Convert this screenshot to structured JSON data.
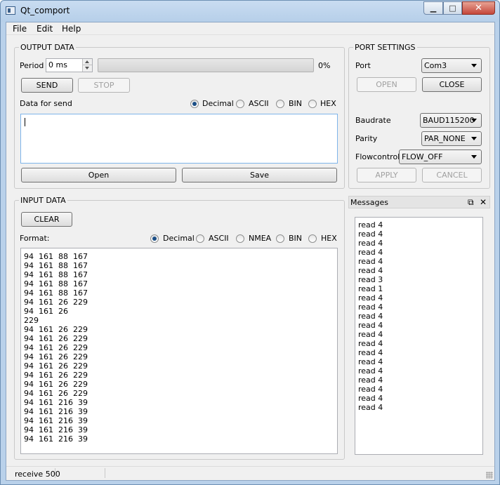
{
  "window": {
    "title": "Qt_comport",
    "minimize": "▁",
    "maximize": "□",
    "close": "✕"
  },
  "menu": [
    "File",
    "Edit",
    "Help"
  ],
  "output": {
    "group_title": "OUTPUT DATA",
    "period_label": "Period",
    "period_value": "0 ms",
    "progress_percent": 0,
    "progress_text": "0%",
    "send_label": "SEND",
    "stop_label": "STOP",
    "data_label": "Data for send",
    "format_options": [
      "Decimal",
      "ASCII",
      "BIN",
      "HEX"
    ],
    "format_selected": "Decimal",
    "text_value": "",
    "open_label": "Open",
    "save_label": "Save"
  },
  "port": {
    "group_title": "PORT SETTINGS",
    "port_label": "Port",
    "port_value": "Com3",
    "open_label": "OPEN",
    "close_label": "CLOSE",
    "baudrate_label": "Baudrate",
    "baudrate_value": "BAUD115200",
    "parity_label": "Parity",
    "parity_value": "PAR_NONE",
    "flow_label": "Flowcontrol",
    "flow_value": "FLOW_OFF",
    "apply_label": "APPLY",
    "cancel_label": "CANCEL"
  },
  "input": {
    "group_title": "INPUT DATA",
    "clear_label": "CLEAR",
    "format_label": "Format:",
    "format_options": [
      "Decimal",
      "ASCII",
      "NMEA",
      "BIN",
      "HEX"
    ],
    "format_selected": "Decimal",
    "lines": [
      "94  161  88  167",
      "94  161  88  167",
      "94  161  88  167",
      "94  161  88  167",
      "94  161  88  167",
      "94  161  26  229",
      "94  161  26",
      "229",
      "94  161  26  229",
      "94  161  26  229",
      "94  161  26  229",
      "94  161  26  229",
      "94  161  26  229",
      "94  161  26  229",
      "94  161  26  229",
      "94  161  26  229",
      "94  161  216  39",
      "94  161  216  39",
      "94  161  216  39",
      "94  161  216  39",
      "94  161  216  39"
    ]
  },
  "messages": {
    "title": "Messages",
    "float_icon": "⧉",
    "close_icon": "✕",
    "lines": [
      "read 4",
      "read 4",
      "read 4",
      "read 4",
      "read 4",
      "read 4",
      "read 3",
      "read 1",
      "read 4",
      "read 4",
      "read 4",
      "read 4",
      "read 4",
      "read 4",
      "read 4",
      "read 4",
      "read 4",
      "read 4",
      "read 4",
      "read 4",
      "read 4"
    ]
  },
  "status": {
    "text": "receive 500"
  }
}
